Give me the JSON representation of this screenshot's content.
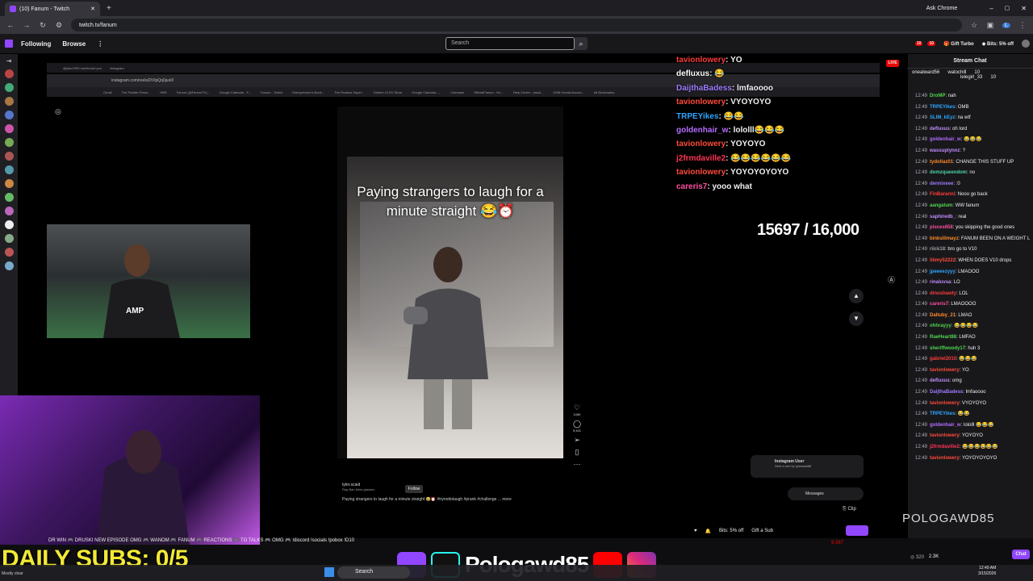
{
  "browser": {
    "tab_title": "(10) Fanum - Twitch",
    "url": "twitch.tv/fanum",
    "ask_chrome": "Ask Chrome"
  },
  "twitch_nav": {
    "following": "Following",
    "browse": "Browse",
    "search_placeholder": "Search",
    "gift_turbo": "Gift Turbo",
    "bits_off": "Bits: 5% off",
    "notif_count_1": "10",
    "notif_count_2": "10"
  },
  "stream": {
    "live_badge": "LIVE",
    "instagram_url": "instagram.com/reels/DVlpQq0jus0/",
    "insta_tab_1": "@tylor1993 mentioned you",
    "insta_tab_2": "Instagram",
    "bookmarks": [
      "Gmail",
      "The Publish Press...",
      "HBR",
      "Fanum (@FanumTV)...",
      "Google Calendar - F...",
      "Fanum - Twitch",
      "Entrepreneur's Book...",
      "The Finance Super...",
      "District 10 NY Store",
      "Google Calendar -...",
      "Coinbase",
      "OfficialFanum - Ho...",
      "Help Center - stock...",
      "2008 Honda Accord...",
      "All Bookmarks"
    ],
    "reel_caption": "Paying strangers to laugh for a minute straight 😂⏰",
    "reel_username": "tyler.scaid",
    "reel_sublabel": "Ray-Ban Meta glasses",
    "follow": "Follow",
    "reel_description": "Paying strangers to laugh for a minute straight 😂⏰ #trynottolaugh #prank #challenge ... more",
    "likes": "146K",
    "comments": "5,441",
    "ig_notif_title": "Instagram User",
    "ig_notif_sub": "Sent a reel by tylorsaid88",
    "messages": "Messages",
    "clip": "Clip",
    "goal": "15697 / 16,000"
  },
  "onscreen_chat": [
    {
      "user": "tavionlowery",
      "msg": "YO",
      "color": "#ff3b3b"
    },
    {
      "user": "defluxus",
      "msg": "😂",
      "color": "#c48cff"
    },
    {
      "user": "DaijthaBadess",
      "msg": "lmfaoooo",
      "color": "#9f7bff"
    },
    {
      "user": "tavionlowery",
      "msg": "VYOYOYO",
      "color": "#ff4a3b"
    },
    {
      "user": "TRPEYikes",
      "msg": "😂😂",
      "color": "#2fa6ff"
    },
    {
      "user": "goldenhair_w",
      "msg": "lololll😂😂😂",
      "color": "#b56cff"
    },
    {
      "user": "tavionlowery",
      "msg": "YOYOYO",
      "color": "#ff4a3b"
    },
    {
      "user": "j2frmdaville2",
      "msg": "😂😂😂😂😂😂",
      "color": "#ff3355"
    },
    {
      "user": "tavionlowery",
      "msg": "YOYOYOYOYO",
      "color": "#ff4a3b"
    },
    {
      "user": "careris7",
      "msg": "yooo what",
      "color": "#ff4fa0"
    }
  ],
  "chat": {
    "title": "Stream Chat",
    "pinned_1_user": "onealward56",
    "pinned_1_count": "10",
    "pinned_2_user": "watochill",
    "pinned_2_count": "10",
    "pinned_3_user": "lelegirl_33",
    "pinned_3_count": "10",
    "messages": [
      {
        "time": "12:49",
        "user": "DroMP",
        "text": "nah",
        "color": "#4fd64f"
      },
      {
        "time": "12:49",
        "user": "TRPEYikes",
        "text": "OMB",
        "color": "#2fa6ff"
      },
      {
        "time": "12:49",
        "user": "SLIM_kEyz",
        "text": "na wtf",
        "color": "#2fa6ff"
      },
      {
        "time": "12:49",
        "user": "defluxus",
        "text": "oh lord",
        "color": "#c48cff"
      },
      {
        "time": "12:49",
        "user": "goldenhair_w",
        "text": "😂😂😂",
        "color": "#b56cff"
      },
      {
        "time": "12:49",
        "user": "wassuplynnz",
        "text": "?",
        "color": "#c48cff"
      },
      {
        "time": "12:49",
        "user": "tydollaz01",
        "text": "CHANGE THIS STUFF UP",
        "color": "#ff8a2b"
      },
      {
        "time": "12:49",
        "user": "domzqueendom",
        "text": "no",
        "color": "#4fd6a5"
      },
      {
        "time": "12:49",
        "user": "dennixeee",
        "text": ":0",
        "color": "#9f7bff"
      },
      {
        "time": "12:49",
        "user": "FinBaranni",
        "text": "Nooo go back",
        "color": "#ff3b3b"
      },
      {
        "time": "12:49",
        "user": "aangatum",
        "text": "WW fanum",
        "color": "#4fd64f"
      },
      {
        "time": "12:49",
        "user": "saphiredb_",
        "text": "real",
        "color": "#c48cff"
      },
      {
        "time": "12:49",
        "user": "pisces658",
        "text": "you skipping the good ones",
        "color": "#ff4fa0"
      },
      {
        "time": "12:49",
        "user": "binkslilmayz",
        "text": "FANUM BEEN ON A WEIGHT LOSS JOURNEY SINCE 2023",
        "color": "#ff8a2b"
      },
      {
        "time": "12:49",
        "user": "riick18",
        "text": "bro go to V10",
        "color": "#9f9fa8"
      },
      {
        "time": "12:49",
        "user": "lilimy52222",
        "text": "WHEN DOES V10 drops",
        "color": "#ff4a3b"
      },
      {
        "time": "12:49",
        "user": "jpeeeezyyy",
        "text": "LMAOOO",
        "color": "#2fa6ff"
      },
      {
        "time": "12:49",
        "user": "rinaluvsa",
        "text": "LO",
        "color": "#c48cff"
      },
      {
        "time": "12:49",
        "user": "dinoshawty",
        "text": "LOL",
        "color": "#ff3b3b"
      },
      {
        "time": "12:49",
        "user": "careris7",
        "text": "LMAOOOO",
        "color": "#ff4fa0"
      },
      {
        "time": "12:49",
        "user": "Daltuby_21",
        "text": "LMAO",
        "color": "#ff8a2b"
      },
      {
        "time": "12:49",
        "user": "ohhrayyy",
        "text": "😂😂😂😂",
        "color": "#4fd64f"
      },
      {
        "time": "12:49",
        "user": "RaeHeart86",
        "text": "LMFAO",
        "color": "#4fd64f"
      },
      {
        "time": "12:49",
        "user": "sheriffwoody17",
        "text": "huh 3",
        "color": "#4fd64f"
      },
      {
        "time": "12:49",
        "user": "gabriel2010",
        "text": "😂😂😂",
        "color": "#ff3b3b"
      },
      {
        "time": "12:49",
        "user": "tavionlowery",
        "text": "YO",
        "color": "#ff4a3b"
      },
      {
        "time": "12:49",
        "user": "defluxus",
        "text": "omg",
        "color": "#c48cff"
      },
      {
        "time": "12:49",
        "user": "DaijthaBadess",
        "text": "lmfaoooo",
        "color": "#9f7bff"
      },
      {
        "time": "12:49",
        "user": "tavionlowery",
        "text": "VYOYOYO",
        "color": "#ff4a3b"
      },
      {
        "time": "12:49",
        "user": "TRPEYikes",
        "text": "😂😂",
        "color": "#2fa6ff"
      },
      {
        "time": "12:49",
        "user": "goldenhair_w",
        "text": "lololll 😂😂😂",
        "color": "#b56cff"
      },
      {
        "time": "12:49",
        "user": "tavionlowery",
        "text": "YOYOYO",
        "color": "#ff4a3b"
      },
      {
        "time": "12:49",
        "user": "j2frmdaville2",
        "text": "😂😂😂😂😂😂",
        "color": "#ff3355"
      },
      {
        "time": "12:49",
        "user": "tavionlowery",
        "text": "YOYOYOYOYO",
        "color": "#ff4a3b"
      }
    ],
    "watermark": "POLOGAWD85",
    "points": "320",
    "points_2": "2.3K",
    "chat_button": "Chat"
  },
  "under_video": {
    "bits_off": "Bits: 5% off",
    "gift_a_sub": "Gift a Sub",
    "viewers": "9,367"
  },
  "overlay": {
    "ticker": "DR WIN 🎮 DRUSKI NEW EPISODE OMG 🎮 WANOM 🎮 FANUM 🎮 REACTIONS 🎮 TO TALKS 🎮 OMG 🎮 !discord !socials !pobox !D10",
    "daily_subs": "DAILY SUBS: 0/5",
    "social_name": "Pologawd85"
  },
  "taskbar": {
    "search": "Search",
    "weather": "Mostly clear",
    "time": "12:49 AM",
    "date": "3/15/2026"
  },
  "colors": {
    "twitch_purple": "#9146ff",
    "live_red": "#eb0400",
    "subs_yellow": "#f2e935"
  }
}
